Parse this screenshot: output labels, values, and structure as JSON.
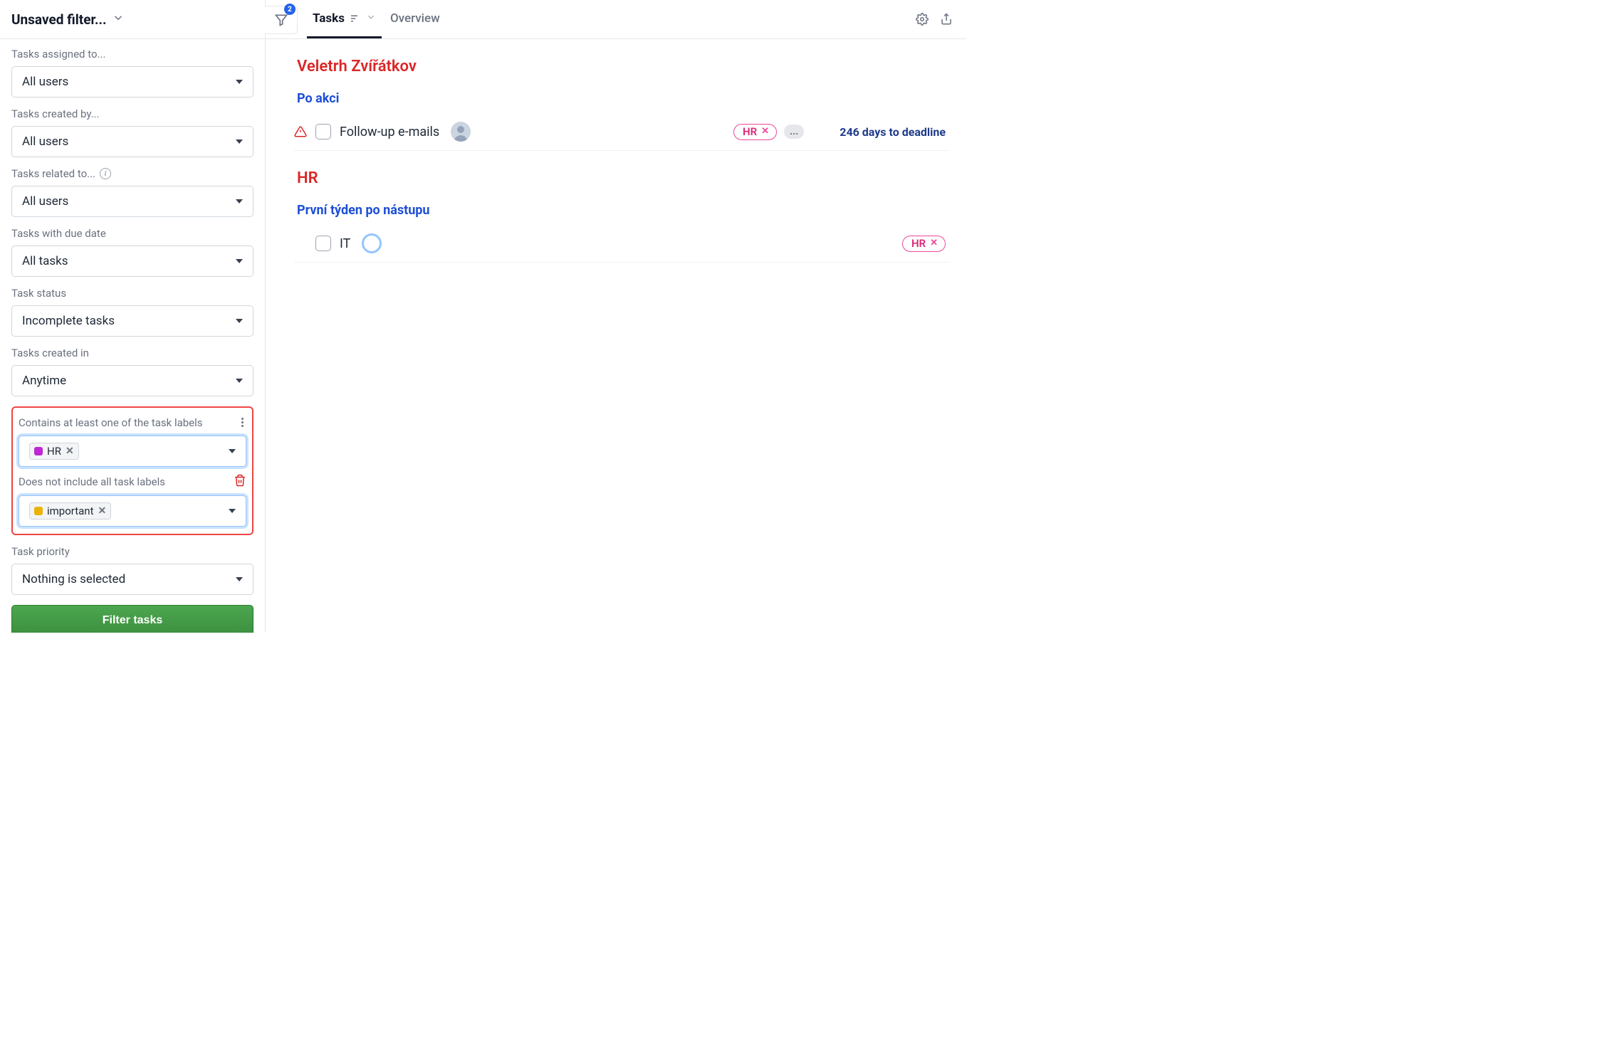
{
  "sidebar": {
    "title": "Unsaved filter...",
    "funnel_badge": "2",
    "filters": {
      "assigned_to": {
        "label": "Tasks assigned to...",
        "value": "All users"
      },
      "created_by": {
        "label": "Tasks created by...",
        "value": "All users"
      },
      "related_to": {
        "label": "Tasks related to...",
        "value": "All users"
      },
      "due_date": {
        "label": "Tasks with due date",
        "value": "All tasks"
      },
      "status": {
        "label": "Task status",
        "value": "Incomplete tasks"
      },
      "created_in": {
        "label": "Tasks created in",
        "value": "Anytime"
      },
      "contains_labels": {
        "label": "Contains at least one of the task labels",
        "chips": [
          {
            "text": "HR",
            "color": "#c026d3"
          }
        ]
      },
      "excludes_labels": {
        "label": "Does not include all task labels",
        "chips": [
          {
            "text": "important",
            "color": "#eab308"
          }
        ]
      },
      "priority": {
        "label": "Task priority",
        "value": "Nothing is selected"
      }
    },
    "filter_button": "Filter tasks"
  },
  "topbar": {
    "tabs": {
      "tasks": "Tasks",
      "overview": "Overview"
    }
  },
  "content": {
    "projects": [
      {
        "title": "Veletrh Zvířátkov",
        "sections": [
          {
            "title": "Po akci",
            "tasks": [
              {
                "has_warning": true,
                "title": "Follow-up e-mails",
                "avatar_type": "photo",
                "labels": [
                  {
                    "text": "HR"
                  }
                ],
                "has_more_labels": true,
                "more_label": "...",
                "deadline": "246 days to deadline"
              }
            ]
          }
        ]
      },
      {
        "title": "HR",
        "sections": [
          {
            "title": "První týden po nástupu",
            "tasks": [
              {
                "has_warning": false,
                "title": "IT",
                "avatar_type": "ring",
                "labels": [
                  {
                    "text": "HR"
                  }
                ],
                "has_more_labels": false,
                "deadline": ""
              }
            ]
          }
        ]
      }
    ]
  }
}
